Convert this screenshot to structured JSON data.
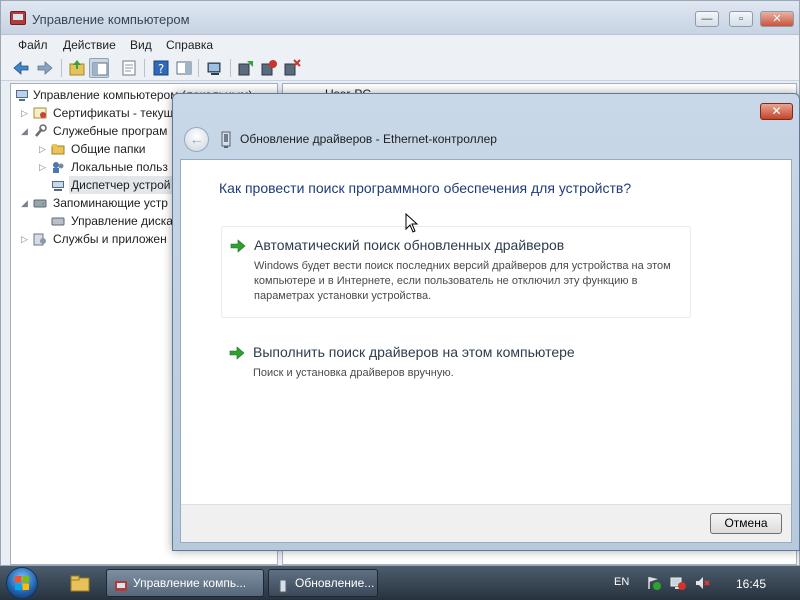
{
  "window": {
    "title": "Управление компьютером",
    "controls": {
      "minimize": "—",
      "maximize": "▫",
      "close": "✕"
    }
  },
  "menu": [
    "Файл",
    "Действие",
    "Вид",
    "Справка"
  ],
  "toolbar_icons": [
    "back-icon",
    "forward-icon",
    "up-icon",
    "show-hide-tree-icon",
    "properties-icon",
    "help-icon",
    "action-pane-icon",
    "scan-hardware-icon",
    "update-driver-icon",
    "disable-device-icon",
    "uninstall-device-icon"
  ],
  "tree": [
    {
      "label": "Управление компьютером (локальным)",
      "icon": "computer-management-icon",
      "expander": ""
    },
    {
      "label": "Сертификаты - текущ",
      "icon": "certificates-icon",
      "expander": "▷"
    },
    {
      "label": "Служебные програм",
      "icon": "tools-icon",
      "expander": "◢"
    },
    {
      "label": "Общие папки",
      "icon": "shared-folders-icon",
      "expander": "▷"
    },
    {
      "label": "Локальные польз",
      "icon": "local-users-icon",
      "expander": "▷"
    },
    {
      "label": "Диспетчер устрой",
      "icon": "device-manager-icon",
      "expander": ""
    },
    {
      "label": "Запоминающие устр",
      "icon": "storage-icon",
      "expander": "◢"
    },
    {
      "label": "Управление диска",
      "icon": "disk-management-icon",
      "expander": ""
    },
    {
      "label": "Службы и приложен",
      "icon": "services-icon",
      "expander": "▷"
    }
  ],
  "right_pane": {
    "header": "User-PC"
  },
  "dialog": {
    "title": "Обновление драйверов - Ethernet-контроллер",
    "close": "✕",
    "back": "←",
    "question": "Как провести поиск программного обеспечения для устройств?",
    "options": [
      {
        "title": "Автоматический поиск обновленных драйверов",
        "description": "Windows будет вести поиск последних версий драйверов для устройства на этом компьютере и в Интернете, если пользователь не отключил эту функцию в параметрах установки устройства."
      },
      {
        "title": "Выполнить поиск драйверов на этом компьютере",
        "description": "Поиск и установка драйверов вручную."
      }
    ],
    "cancel": "Отмена"
  },
  "taskbar": {
    "tasks": [
      {
        "label": "Управление компь...",
        "state": "active"
      },
      {
        "label": "Обновление...",
        "state": "inactive"
      }
    ],
    "language": "EN",
    "clock": "16:45",
    "tray_icons": [
      "action-center-icon",
      "network-icon",
      "volume-muted-icon"
    ]
  },
  "colors": {
    "accent_green": "#2ea12e",
    "question_blue": "#1f3b7a",
    "close_red": "#c5432b"
  }
}
